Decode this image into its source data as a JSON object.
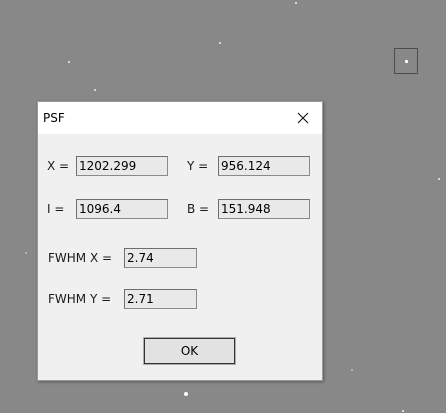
{
  "dialog": {
    "title": "PSF",
    "fields": {
      "x": {
        "label": "X =",
        "value": "1202.299"
      },
      "y": {
        "label": "Y =",
        "value": "956.124"
      },
      "i": {
        "label": "I =",
        "value": "1096.4"
      },
      "b": {
        "label": "B =",
        "value": "151.948"
      },
      "fwhm_x": {
        "label": "FWHM X =",
        "value": "2.74"
      },
      "fwhm_y": {
        "label": "FWHM Y =",
        "value": "2.71"
      }
    },
    "ok_label": "OK"
  },
  "icons": {
    "close": "close-icon"
  },
  "colors": {
    "background": "#888888",
    "dialog": "#f0f0f0"
  }
}
